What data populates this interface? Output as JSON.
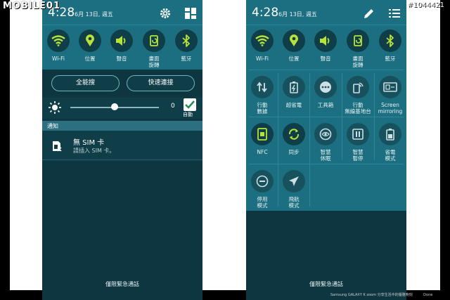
{
  "watermark": {
    "logo": "MOBILE01",
    "post_id": "#1044421"
  },
  "left_panel": {
    "time": "4:28",
    "date": "6月 13日, 週五",
    "quick_settings": [
      {
        "label": "Wi-Fi",
        "icon": "wifi-icon"
      },
      {
        "label": "位置",
        "icon": "location-icon"
      },
      {
        "label": "聲音",
        "icon": "sound-icon"
      },
      {
        "label": "畫面\n旋轉",
        "icon": "rotate-icon"
      },
      {
        "label": "藍牙",
        "icon": "bluetooth-icon"
      }
    ],
    "buttons": {
      "search": "全能搜",
      "connect": "快速連接"
    },
    "brightness": {
      "value": "0",
      "auto_label": "自動",
      "level": 0.5
    },
    "notifications": {
      "header": "通知",
      "items": [
        {
          "title": "無 SIM 卡",
          "subtitle": "請插入 SIM 卡。",
          "icon": "sim-card-icon"
        }
      ]
    },
    "emergency": "僅限緊急通話"
  },
  "right_panel": {
    "time": "4:28",
    "date": "6月 13日, 週五",
    "grid_rows": [
      [
        {
          "label": "Wi-Fi",
          "icon": "wifi-icon"
        },
        {
          "label": "位置",
          "icon": "location-icon"
        },
        {
          "label": "聲音",
          "icon": "sound-icon"
        },
        {
          "label": "畫面\n旋轉",
          "icon": "rotate-icon"
        },
        {
          "label": "藍牙",
          "icon": "bluetooth-icon"
        }
      ],
      [
        {
          "label": "行動\n數據",
          "icon": "mobile-data-icon"
        },
        {
          "label": "超省電",
          "icon": "ultra-power-saving-icon"
        },
        {
          "label": "工具箱",
          "icon": "toolbox-icon"
        },
        {
          "label": "行動\n無線基地台",
          "icon": "hotspot-icon"
        },
        {
          "label": "Screen\nmirroring",
          "icon": "screen-mirroring-icon"
        }
      ],
      [
        {
          "label": "NFC",
          "icon": "nfc-icon"
        },
        {
          "label": "同步",
          "icon": "sync-icon"
        },
        {
          "label": "智慧\n休眠",
          "icon": "smart-stay-icon"
        },
        {
          "label": "智慧\n暫停",
          "icon": "smart-pause-icon"
        },
        {
          "label": "省電\n模式",
          "icon": "power-saving-icon"
        }
      ],
      [
        {
          "label": "停用\n模式",
          "icon": "blocking-mode-icon"
        },
        {
          "label": "飛航\n模式",
          "icon": "airplane-mode-icon"
        }
      ]
    ],
    "emergency": "僅限緊急通話"
  },
  "footer": {
    "caption": "Samsung GALAXY K zoom 分享生活中的優雅時刻",
    "done": "Done"
  },
  "colors": {
    "accent": "#b8e23a",
    "panel": "#1c6f80",
    "background": "#0e3640"
  }
}
